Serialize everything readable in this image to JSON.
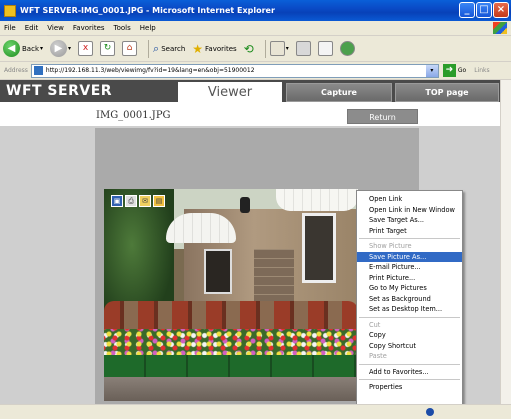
{
  "window": {
    "title": "WFT SERVER-IMG_0001.JPG - Microsoft Internet Explorer",
    "min_label": "_",
    "max_label": "□",
    "close_label": "×"
  },
  "menubar": [
    "File",
    "Edit",
    "View",
    "Favorites",
    "Tools",
    "Help"
  ],
  "toolbar": {
    "back_label": "Back",
    "back_glyph": "◀",
    "forward_glyph": "▶",
    "stop_glyph": "x",
    "refresh_glyph": "↻",
    "home_glyph": "⌂",
    "search_label": "Search",
    "search_glyph": "⌕",
    "favorites_label": "Favorites",
    "favorites_glyph": "★",
    "history_glyph": "⟲",
    "dropdown_glyph": "▾"
  },
  "address": {
    "label": "Address",
    "url": "http://192.168.11.3/web/viewimg/fv?id=19&lang=en&obj=51900012",
    "go_label": "Go",
    "go_glyph": "➜",
    "links_label": "Links"
  },
  "header": {
    "logo": "WFT SERVER",
    "tabs": {
      "viewer": "Viewer",
      "capture": "Capture",
      "top": "TOP page"
    }
  },
  "viewer": {
    "filename": "IMG_0001.JPG",
    "return_label": "Return",
    "tool_glyphs": {
      "save": "▣",
      "print": "⎙",
      "mail": "✉",
      "folder": "▤"
    }
  },
  "context_menu": {
    "open_link": "Open Link",
    "open_link_new_window": "Open Link in New Window",
    "save_target_as": "Save Target As...",
    "print_target": "Print Target",
    "show_picture": "Show Picture",
    "save_picture_as": "Save Picture As...",
    "email_picture": "E-mail Picture...",
    "print_picture": "Print Picture...",
    "go_to_my_pictures": "Go to My Pictures",
    "set_as_background": "Set as Background",
    "set_as_desktop_item": "Set as Desktop Item...",
    "cut": "Cut",
    "copy": "Copy",
    "copy_shortcut": "Copy Shortcut",
    "paste": "Paste",
    "add_to_favorites": "Add to Favorites...",
    "properties": "Properties"
  },
  "colors": {
    "titlebar": "#0a4ac6",
    "header_bg": "#4a4a4a",
    "menu_highlight": "#316ac5"
  }
}
